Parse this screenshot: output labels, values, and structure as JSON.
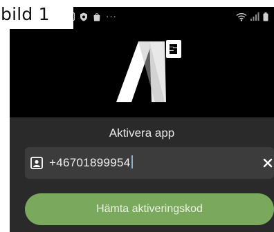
{
  "caption": {
    "text": "bild 1"
  },
  "status_bar": {
    "left_icons": [
      "gallery-icon",
      "shield-icon",
      "shopping-bag-icon"
    ],
    "overflow": "···",
    "right_icons": [
      "wifi-icon",
      "signal-icon",
      "battery-icon"
    ]
  },
  "logo": {
    "icon": "a3-logo-icon"
  },
  "activation": {
    "title": "Aktivera app",
    "phone_field": {
      "icon": "contact-card-icon",
      "value": "+46701899954",
      "clear_icon": "close-icon"
    },
    "primary_button": {
      "label": "Hämta aktiveringskod",
      "color": "#7aa85c"
    }
  },
  "colors": {
    "background": "#000000",
    "panel": "#2a2a2a",
    "field": "#3c3c3c",
    "accent": "#7aa85c"
  }
}
